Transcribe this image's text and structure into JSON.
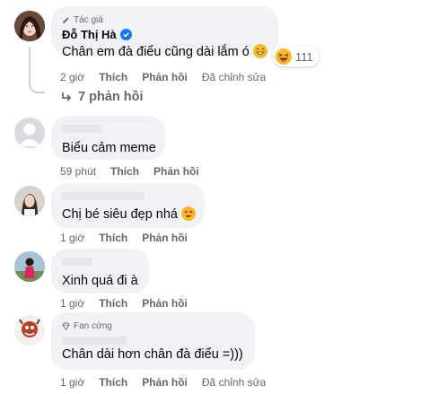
{
  "comments": [
    {
      "badge": "Tác giả",
      "author": "Đỗ Thị Hà",
      "text": "Chân em đà điểu cũng dài lắm ó",
      "time": "2 giờ",
      "like": "Thích",
      "reply": "Phản hồi",
      "edited": "Đã chỉnh sửa",
      "reaction_count": "111",
      "replies_label": "7 phản hồi"
    },
    {
      "text": "Biểu cảm meme",
      "time": "59 phút",
      "like": "Thích",
      "reply": "Phản hồi"
    },
    {
      "text": "Chị bé siêu đẹp nhá",
      "time": "1 giờ",
      "like": "Thích",
      "reply": "Phản hồi"
    },
    {
      "text": "Xinh quá đi à",
      "time": "1 giờ",
      "like": "Thích",
      "reply": "Phản hồi"
    },
    {
      "badge": "Fan cứng",
      "text": "Chân dài hơn chân đà điểu =)))",
      "time": "1 giờ",
      "like": "Thích",
      "reply": "Phản hồi",
      "edited": "Đã chỉnh sửa"
    }
  ],
  "icons": {
    "pen": "pen-icon",
    "verified": "verified-badge-icon",
    "reply_arrow": "reply-arrow-icon",
    "diamond": "diamond-icon"
  },
  "colors": {
    "bubble": "#f0f2f5",
    "meta_text": "#65676b",
    "verified": "#1877f2",
    "emoji_yellow": "#f7b928"
  }
}
